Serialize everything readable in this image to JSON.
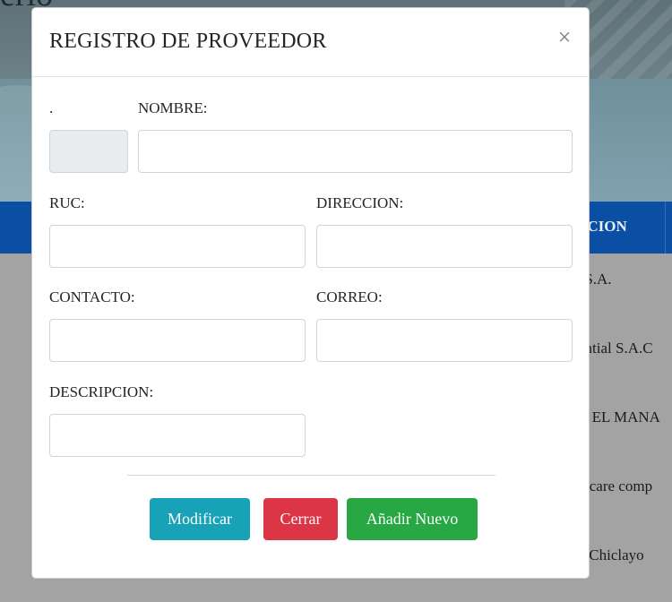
{
  "background": {
    "hero_title_fragment": "erio",
    "table_header_fragment": "PCION",
    "rows": [
      "' S.A.",
      "antial S.A.C",
      "A EL MANA",
      "y care comp",
      "s-Chiclayo"
    ]
  },
  "modal": {
    "title": "REGISTRO DE PROVEEDOR",
    "close_symbol": "×",
    "fields": {
      "id": {
        "label": ".",
        "value": ""
      },
      "nombre": {
        "label": "NOMBRE:",
        "value": ""
      },
      "ruc": {
        "label": "RUC:",
        "value": ""
      },
      "direccion": {
        "label": "DIRECCION:",
        "value": ""
      },
      "contacto": {
        "label": "CONTACTO:",
        "value": ""
      },
      "correo": {
        "label": "CORREO:",
        "value": ""
      },
      "descripcion": {
        "label": "DESCRIPCION:",
        "value": ""
      }
    },
    "buttons": {
      "modificar": "Modificar",
      "cerrar": "Cerrar",
      "nuevo": "Añadir Nuevo"
    }
  },
  "colors": {
    "overlay": "#9a9a9a",
    "table_header": "#0a4fa3",
    "btn_info": "#17a2b8",
    "btn_danger": "#dc3545",
    "btn_success": "#28a745"
  }
}
